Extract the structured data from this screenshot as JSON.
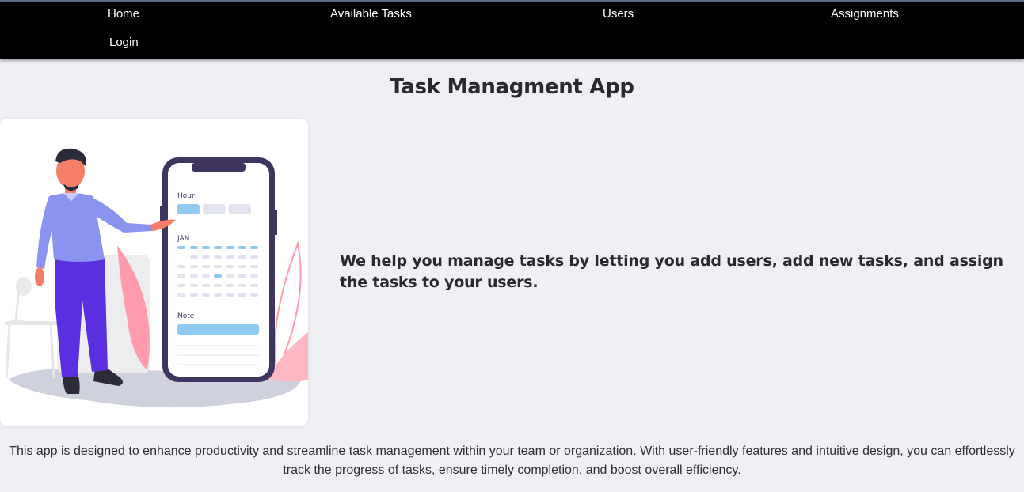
{
  "nav": {
    "home": "Home",
    "available_tasks": "Available Tasks",
    "users": "Users",
    "assignments": "Assignments",
    "login": "Login"
  },
  "page": {
    "title": "Task Managment App",
    "tagline": "We help you manage tasks by letting you add users, add new tasks, and assign the tasks to your users.",
    "description": "This app is designed to enhance productivity and streamline task management within your team or organization. With user-friendly features and intuitive design, you can effortlessly track the progress of tasks, ensure timely completion, and boost overall efficiency."
  },
  "illustration": {
    "phone_hour_label": "Hour",
    "phone_month_label": "JAN",
    "phone_note_label": "Note"
  },
  "colors": {
    "navbar_bg": "#000000",
    "page_bg": "#eff0f4",
    "phone_frame": "#3f3560",
    "accent_blue": "#8fcaf3",
    "shirt": "#8b93f0",
    "pants": "#5b2fe0",
    "leaf_pink": "#ff9bad"
  }
}
